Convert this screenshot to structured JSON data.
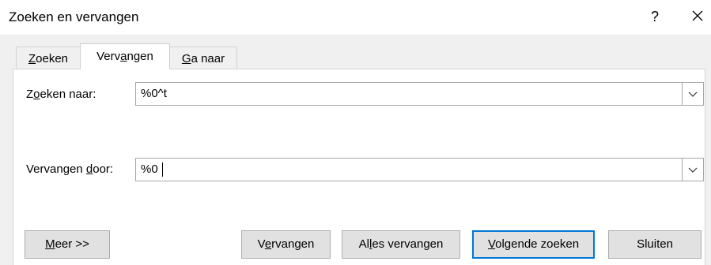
{
  "window": {
    "title": "Zoeken en vervangen",
    "help_label": "?"
  },
  "tabs": [
    {
      "pre": "",
      "acc": "Z",
      "post": "oeken"
    },
    {
      "pre": "Verv",
      "acc": "a",
      "post": "ngen"
    },
    {
      "pre": "",
      "acc": "G",
      "post": "a naar"
    }
  ],
  "search": {
    "label": {
      "pre": "Z",
      "acc": "o",
      "post": "eken naar:"
    },
    "value": "%0^t"
  },
  "replace": {
    "label": {
      "pre": "Vervangen ",
      "acc": "d",
      "post": "oor:"
    },
    "value": "%0 "
  },
  "buttons": {
    "more": {
      "pre": "",
      "acc": "M",
      "post": "eer >>"
    },
    "replace": {
      "pre": "V",
      "acc": "e",
      "post": "rvangen"
    },
    "replace_all": {
      "pre": "Al",
      "acc": "l",
      "post": "es vervangen"
    },
    "find_next": {
      "pre": "",
      "acc": "V",
      "post": "olgende zoeken"
    },
    "close": {
      "pre": "Sluiten",
      "acc": "",
      "post": ""
    }
  },
  "colors": {
    "accent": "#0078d7",
    "dialog_bg": "#f0f0f0"
  }
}
